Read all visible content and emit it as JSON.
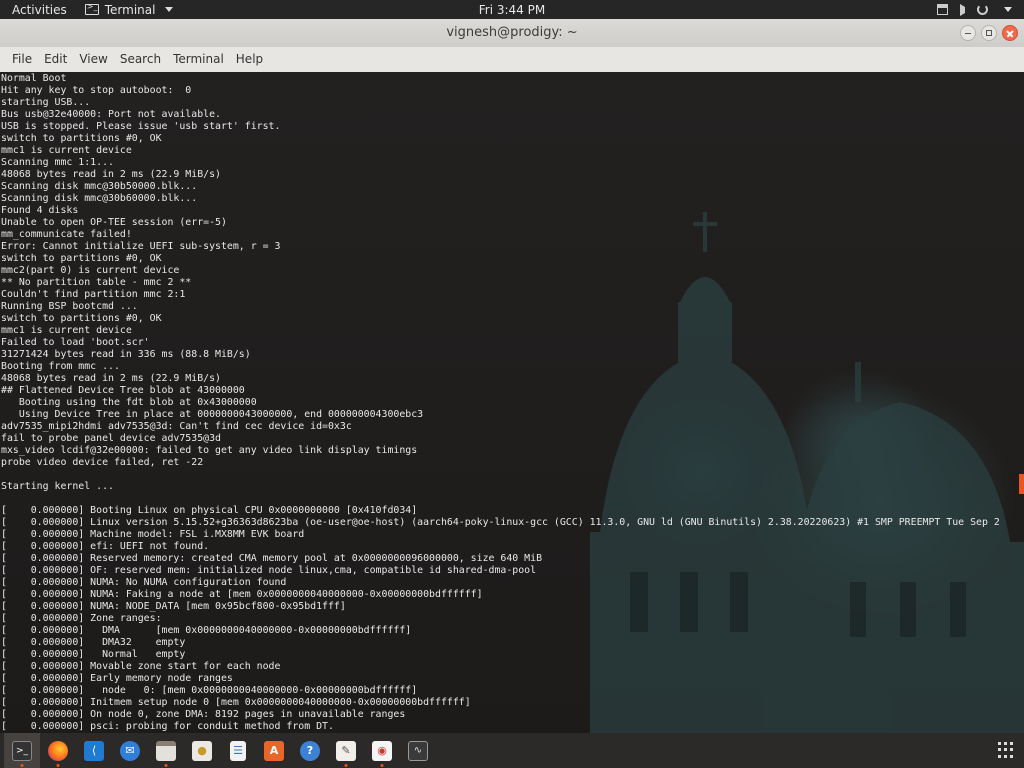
{
  "topbar": {
    "activities": "Activities",
    "app_name": "Terminal",
    "clock": "Fri  3:44 PM"
  },
  "window": {
    "title": "vignesh@prodigy: ~"
  },
  "menu": [
    "File",
    "Edit",
    "View",
    "Search",
    "Terminal",
    "Help"
  ],
  "terminal": {
    "lines": [
      "Normal Boot",
      "Hit any key to stop autoboot:  0",
      "starting USB...",
      "Bus usb@32e40000: Port not available.",
      "USB is stopped. Please issue 'usb start' first.",
      "switch to partitions #0, OK",
      "mmc1 is current device",
      "Scanning mmc 1:1...",
      "48068 bytes read in 2 ms (22.9 MiB/s)",
      "Scanning disk mmc@30b50000.blk...",
      "Scanning disk mmc@30b60000.blk...",
      "Found 4 disks",
      "Unable to open OP-TEE session (err=-5)",
      "mm_communicate failed!",
      "Error: Cannot initialize UEFI sub-system, r = 3",
      "switch to partitions #0, OK",
      "mmc2(part 0) is current device",
      "** No partition table - mmc 2 **",
      "Couldn't find partition mmc 2:1",
      "Running BSP bootcmd ...",
      "switch to partitions #0, OK",
      "mmc1 is current device",
      "Failed to load 'boot.scr'",
      "31271424 bytes read in 336 ms (88.8 MiB/s)",
      "Booting from mmc ...",
      "48068 bytes read in 2 ms (22.9 MiB/s)",
      "## Flattened Device Tree blob at 43000000",
      "   Booting using the fdt blob at 0x43000000",
      "   Using Device Tree in place at 0000000043000000, end 000000004300ebc3",
      "adv7535_mipi2hdmi adv7535@3d: Can't find cec device id=0x3c",
      "fail to probe panel device adv7535@3d",
      "mxs_video lcdif@32e00000: failed to get any video link display timings",
      "probe video device failed, ret -22",
      "",
      "Starting kernel ...",
      "",
      "[    0.000000] Booting Linux on physical CPU 0x0000000000 [0x410fd034]",
      "[    0.000000] Linux version 5.15.52+g36363d8623ba (oe-user@oe-host) (aarch64-poky-linux-gcc (GCC) 11.3.0, GNU ld (GNU Binutils) 2.38.20220623) #1 SMP PREEMPT Tue Sep 2",
      "[    0.000000] Machine model: FSL i.MX8MM EVK board",
      "[    0.000000] efi: UEFI not found.",
      "[    0.000000] Reserved memory: created CMA memory pool at 0x0000000096000000, size 640 MiB",
      "[    0.000000] OF: reserved mem: initialized node linux,cma, compatible id shared-dma-pool",
      "[    0.000000] NUMA: No NUMA configuration found",
      "[    0.000000] NUMA: Faking a node at [mem 0x0000000040000000-0x00000000bdffffff]",
      "[    0.000000] NUMA: NODE_DATA [mem 0x95bcf800-0x95bd1fff]",
      "[    0.000000] Zone ranges:",
      "[    0.000000]   DMA      [mem 0x0000000040000000-0x00000000bdffffff]",
      "[    0.000000]   DMA32    empty",
      "[    0.000000]   Normal   empty",
      "[    0.000000] Movable zone start for each node",
      "[    0.000000] Early memory node ranges",
      "[    0.000000]   node   0: [mem 0x0000000040000000-0x00000000bdffffff]",
      "[    0.000000] Initmem setup node 0 [mem 0x0000000040000000-0x00000000bdffffff]",
      "[    0.000000] On node 0, zone DMA: 8192 pages in unavailable ranges",
      "[    0.000000] psci: probing for conduit method from DT."
    ]
  },
  "dock": {
    "apps": [
      {
        "icon": "terminal-icon",
        "active": true
      },
      {
        "icon": "firefox-icon",
        "active": false
      },
      {
        "icon": "vscode-icon",
        "active": false
      },
      {
        "icon": "thunderbird-icon",
        "active": false
      },
      {
        "icon": "files-icon",
        "active": false
      },
      {
        "icon": "software-icon",
        "active": false
      },
      {
        "icon": "document-viewer-icon",
        "active": false
      },
      {
        "icon": "app-store-icon",
        "active": false
      },
      {
        "icon": "help-icon",
        "active": false
      },
      {
        "icon": "text-editor-icon",
        "active": false
      },
      {
        "icon": "screenshot-icon",
        "active": false
      },
      {
        "icon": "system-monitor-icon",
        "active": false
      }
    ]
  },
  "colors": {
    "accent": "#e95420",
    "terminal_text": "#e8e8e8",
    "topbar_bg": "#262626"
  }
}
